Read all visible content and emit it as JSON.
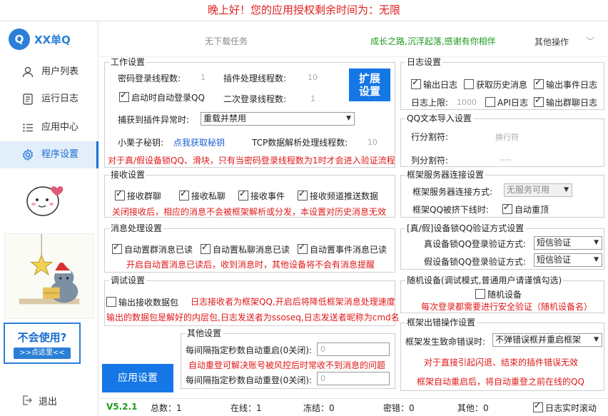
{
  "banner": "晚上好！您的应用授权剩余时间为：无限",
  "app": {
    "logo_text": "XX单Q"
  },
  "sidebar": {
    "items": [
      {
        "label": "用户列表"
      },
      {
        "label": "运行日志"
      },
      {
        "label": "应用中心"
      },
      {
        "label": "程序设置"
      }
    ],
    "help_title": "不会使用?",
    "help_button": ">>点这里<<",
    "logout": "退出"
  },
  "topbar": {
    "task_status": "无下载任务",
    "slogan": "成长之路,沉浮起落,感谢有你相伴",
    "other_ops": "其他操作"
  },
  "work": {
    "title": "工作设置",
    "pwd_threads_label": "密码登录线程数:",
    "pwd_threads_value": "1",
    "plugin_threads_label": "插件处理线程数:",
    "plugin_threads_value": "10",
    "autologin_label": "启动时自动登录QQ",
    "second_threads_label": "二次登录线程数:",
    "second_threads_value": "1",
    "expand_btn_line1": "扩展",
    "expand_btn_line2": "设置",
    "exception_label": "捕获到插件异常时:",
    "exception_value": "重载并禁用",
    "key_label": "小栗子秘钥:",
    "key_link": "点我获取秘钥",
    "tcp_label": "TCP数据解析处理线程数:",
    "tcp_value": "10",
    "warning": "对于真/假设备锁QQ、滑块，只有当密码登录线程数为1时才会进入验证流程"
  },
  "receive": {
    "title": "接收设置",
    "group_label": "接收群聊",
    "private_label": "接收私聊",
    "event_label": "接收事件",
    "channel_label": "接收频道推送数据",
    "note": "关闭接收后，相应的消息不会被框架解析或分发，本设置对历史消息无效"
  },
  "msg": {
    "title": "消息处理设置",
    "group_read": "自动置群消息已读",
    "private_read": "自动置私聊消息已读",
    "event_read": "自动置事件消息已读",
    "note": "开启自动置消息已读后，收到消息时，其他设备将不会有消息提醒"
  },
  "debug": {
    "title": "调试设置",
    "output_packets": "输出接收数据包",
    "note1": "日志接收者为框架QQ,开启后将降低框架消息处理速度",
    "note2": "输出的数据包是解好的内层包,日志发送者为ssoseq,日志发送者昵称为cmd名"
  },
  "other": {
    "title": "其他设置",
    "restart_label": "每间隔指定秒数自动重启(0关闭):",
    "restart_value": "0",
    "relogin_note": "自动重登可解决账号被风控后时常收不到消息的问题",
    "relogin_label": "每间隔指定秒数自动重登(0关闭):",
    "relogin_value": "0"
  },
  "apply_button": "应用设置",
  "log": {
    "title": "日志设置",
    "output_log": "输出日志",
    "history": "获取历史消息",
    "event_log": "输出事件日志",
    "limit_label": "日志上限:",
    "limit_value": "1000",
    "api_log": "API日志",
    "group_log": "输出群聊日志"
  },
  "import": {
    "title": "QQ文本导入设置",
    "row_sep_label": "行分割符:",
    "row_sep_value": "换行符",
    "col_sep_label": "列分割符:",
    "col_sep_value": "----"
  },
  "server": {
    "title": "框架服务器连接设置",
    "mode_label": "框架服务器连接方式:",
    "mode_value": "无服务可用",
    "kick_label": "框架QQ被挤下线时:",
    "kick_check": "自动重顶"
  },
  "devlock": {
    "title": "[真/假]设备锁QQ验证方式设置",
    "real_label": "真设备锁QQ登录验证方式:",
    "real_value": "短信验证",
    "fake_label": "假设备锁QQ登录验证方式:",
    "fake_value": "短信验证"
  },
  "random": {
    "title": "随机设备(调试模式,普通用户请谨慎勾选)",
    "check": "随机设备",
    "note": "每次登录都需要进行安全验证（随机设备名）"
  },
  "error": {
    "title": "框架出错操作设置",
    "fatal_label": "框架发生致命错误时:",
    "fatal_value": "不弹错误框并重启框架",
    "note1": "对于直接引起闪退、结束的插件错误无效",
    "note2": "框架自动重启后，将自动重登之前在线的QQ"
  },
  "status": {
    "version": "V5.2.1",
    "total": "总数：1",
    "online": "在线：1",
    "frozen": "冻结：0",
    "banned": "密错：0",
    "other": "其他：0",
    "scroll": "日志实时滚动"
  },
  "colors": {
    "accent": "#1576e6",
    "warning": "#e01818",
    "slogan": "#1e9a1e"
  }
}
